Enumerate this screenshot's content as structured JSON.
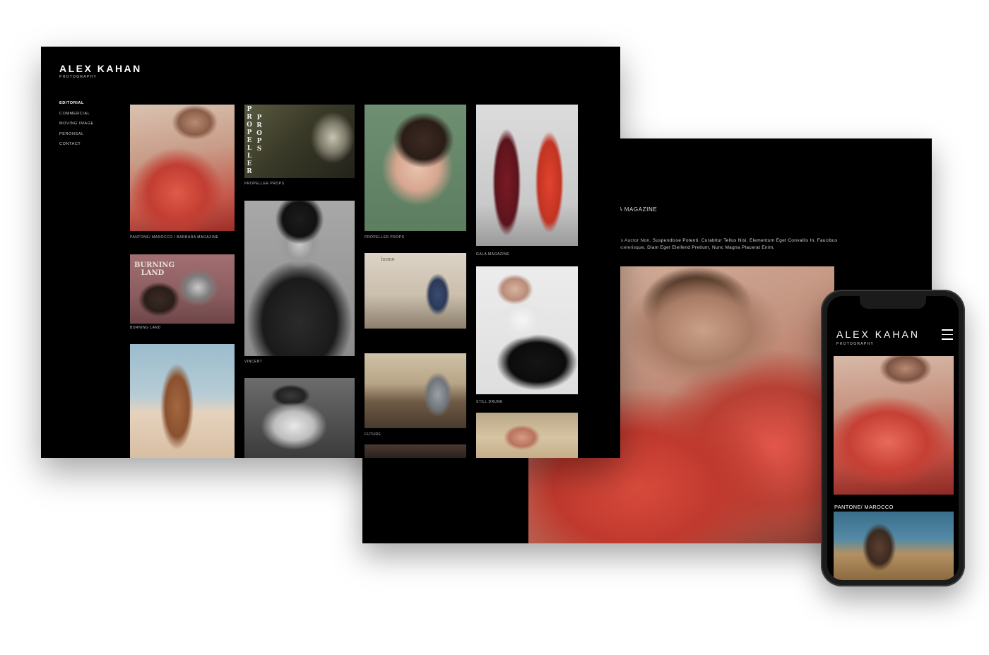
{
  "brand": {
    "name": "ALEX KAHAN",
    "sub": "PHOTOGRAPHY"
  },
  "nav": {
    "items": [
      {
        "label": "EDITORIAL",
        "active": true
      },
      {
        "label": "COMMERCIAL",
        "active": false
      },
      {
        "label": "MOVING IMAGE",
        "active": false
      },
      {
        "label": "PERONSAL",
        "active": false
      },
      {
        "label": "CONTACT",
        "active": false
      }
    ]
  },
  "gallery": {
    "captions": {
      "pantone": "PANTONE/ MAROCCO / BARBARA MAGAZINE",
      "propeller_1": "PROPELLER PROPS",
      "propeller_2": "PROPELLER PROPS",
      "gala": "GALA MAGAZINE",
      "burning": "BURNING LAND",
      "vincent": "VINCENT",
      "still_drunk": "STILL DRUNK",
      "future": "FUTURE"
    },
    "overlays": {
      "propeller_left": "PROPELLER",
      "propeller_right": "PROPS",
      "burning_title": "BURNING LAND",
      "home_sign": "home"
    }
  },
  "detail": {
    "title": "RA MAGAZINE",
    "body_line1": "ctus Auctor Non. Suspendisse Potenti. Curabitur Tellus Nisl, Elementum Eget Convallis In, Faucibus",
    "body_line2": "s Scelerisque, Diam Eget Eleifend Pretium, Nunc Magna Placerat Enim,"
  },
  "phone": {
    "brand_name": "ALEX KAHAN",
    "brand_sub": "PHOTOGRAPHY",
    "caption": "PANTONE/ MAROCCO",
    "menu_icon": "hamburger-icon"
  },
  "colors": {
    "background": "#ffffff",
    "screen": "#000000",
    "text": "#ffffff",
    "muted_text": "#bdbdbd",
    "phone_frame": "#1b1b1c"
  }
}
